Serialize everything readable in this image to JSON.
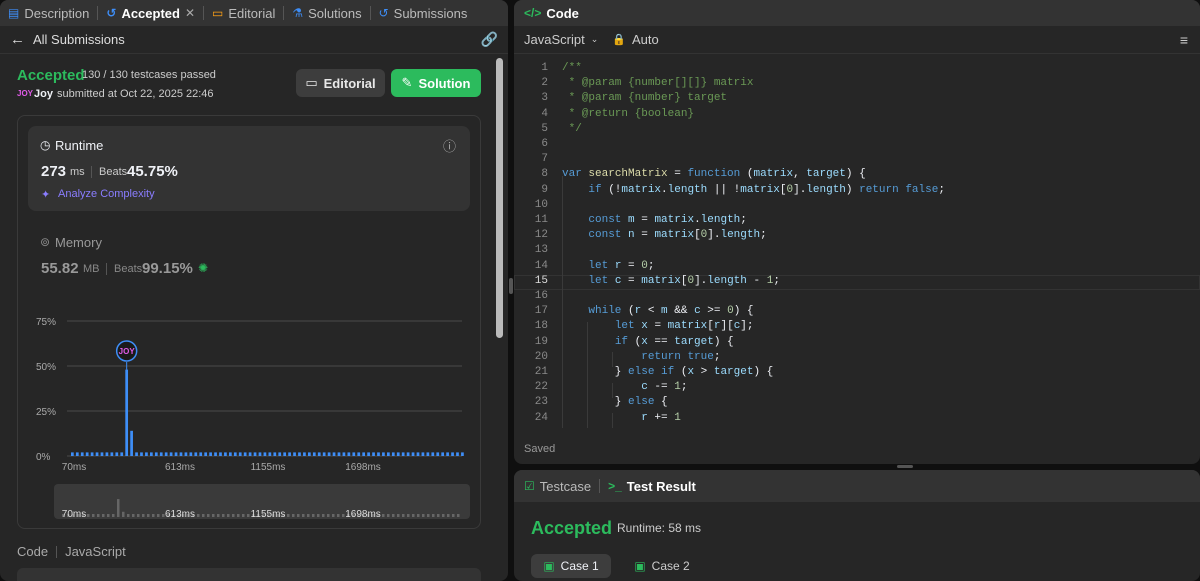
{
  "left_tabs": [
    {
      "label": "Description",
      "icon": "description-icon"
    },
    {
      "label": "Accepted",
      "icon": "history-icon",
      "close": "✕"
    },
    {
      "label": "Editorial",
      "icon": "book-icon"
    },
    {
      "label": "Solutions",
      "icon": "flask-icon"
    },
    {
      "label": "Submissions",
      "icon": "history-icon"
    }
  ],
  "all_submissions": "All Submissions",
  "result": {
    "status": "Accepted",
    "testcases": "130 / 130 testcases passed",
    "avatar_text": "JOY",
    "user": "Joy",
    "submitted": "submitted at Oct 22, 2025 22:46",
    "editorial_btn": "Editorial",
    "solution_btn": "Solution"
  },
  "runtime": {
    "title": "Runtime",
    "value": "273",
    "unit": "ms",
    "beats_label": "Beats",
    "beats_value": "45.75%",
    "analyze": "Analyze Complexity"
  },
  "memory": {
    "title": "Memory",
    "value": "55.82",
    "unit": "MB",
    "beats_label": "Beats",
    "beats_value": "99.15%"
  },
  "chart_data": {
    "type": "bar",
    "y_ticks": [
      "75%",
      "50%",
      "25%",
      "0%"
    ],
    "ylim": [
      0,
      75
    ],
    "x_ticks": [
      "70ms",
      "613ms",
      "1155ms",
      "1698ms"
    ],
    "highlight_label": "JOY",
    "values": [
      2,
      2,
      2,
      2,
      2,
      2,
      2,
      2,
      2,
      2,
      2,
      48,
      14,
      2,
      2,
      2,
      2,
      2,
      2,
      2,
      2,
      2,
      2,
      2,
      2,
      2,
      2,
      2,
      2,
      2,
      2,
      2,
      2,
      2,
      2,
      2,
      2,
      2,
      2,
      2,
      2,
      2,
      2,
      2,
      2,
      2,
      2,
      2,
      2,
      2,
      2,
      2,
      2,
      2,
      2,
      2,
      2,
      2,
      2,
      2,
      2,
      2,
      2,
      2,
      2,
      2,
      2,
      2,
      2,
      2,
      2,
      2,
      2,
      2,
      2,
      2,
      2,
      2,
      2,
      2
    ],
    "highlight_index": 11,
    "grid": true
  },
  "footer": {
    "code": "Code",
    "lang": "JavaScript"
  },
  "code_tab": "Code",
  "editor": {
    "language": "JavaScript",
    "mode": "Auto",
    "saved": "Saved",
    "lines": [
      "/**",
      " * @param {number[][]} matrix",
      " * @param {number} target",
      " * @return {boolean}",
      " */",
      "",
      "",
      "var searchMatrix = function (matrix, target) {",
      "    if (!matrix.length || !matrix[0].length) return false;",
      "",
      "    const m = matrix.length;",
      "    const n = matrix[0].length;",
      "",
      "    let r = 0;",
      "    let c = matrix[0].length - 1;",
      "",
      "    while (r < m && c >= 0) {",
      "        let x = matrix[r][c];",
      "        if (x == target) {",
      "            return true;",
      "        } else if (x > target) {",
      "            c -= 1;",
      "        } else {",
      "            r += 1"
    ]
  },
  "bottom": {
    "testcase_tab": "Testcase",
    "result_tab": "Test Result",
    "status": "Accepted",
    "runtime": "Runtime: 58 ms",
    "cases": [
      "Case 1",
      "Case 2"
    ]
  }
}
